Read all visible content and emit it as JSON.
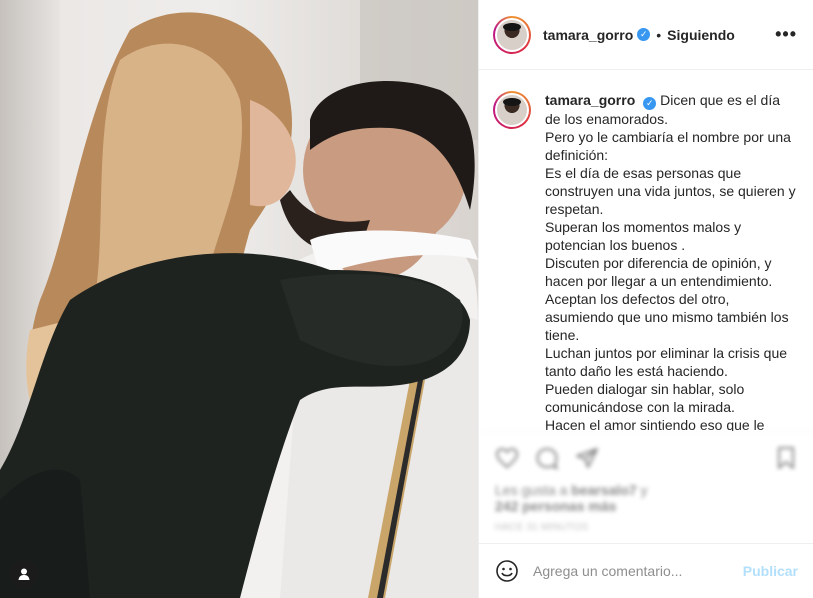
{
  "post": {
    "username": "tamara_gorro",
    "verified_icon": "verified-badge-icon",
    "separator": "•",
    "follow_status": "Siguiendo",
    "more_icon": "more-options-icon"
  },
  "caption": {
    "username": "tamara_gorro",
    "text": "Dicen que es el día de los enamorados.\nPero yo le cambiaría el nombre por una definición:\nEs el día de esas personas que construyen una vida juntos, se quieren y respetan.\nSuperan los momentos malos y potencian los buenos .\nDiscuten por diferencia de opinión, y hacen por llegar a un entendimiento.\nAceptan los defectos del otro, asumiendo que uno mismo también los tiene.\nLuchan juntos por eliminar la crisis que tanto daño les está haciendo.\nPueden dialogar sin hablar, solo comunicándose con la mirada.\nHacen el amor sintiendo eso que le"
  },
  "actions": {
    "likes_prefix": "Les gusta a ",
    "likes_user": "bearsalo7",
    "likes_suffix": " y",
    "likes_count": "242 personas más",
    "time": "HACE 31 MINUTOS"
  },
  "comment": {
    "placeholder": "Agrega un comentario...",
    "publish_label": "Publicar",
    "emoji_icon": "emoji-icon"
  },
  "colors": {
    "verified": "#3897f0",
    "publish_disabled": "#b2dffc",
    "text": "#262626",
    "muted": "#8e8e8e"
  }
}
